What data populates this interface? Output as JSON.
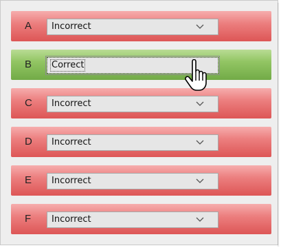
{
  "rows": [
    {
      "label": "A",
      "value": "Incorrect",
      "state": "incorrect"
    },
    {
      "label": "B",
      "value": "Correct",
      "state": "correct"
    },
    {
      "label": "C",
      "value": "Incorrect",
      "state": "incorrect"
    },
    {
      "label": "D",
      "value": "Incorrect",
      "state": "incorrect"
    },
    {
      "label": "E",
      "value": "Incorrect",
      "state": "incorrect"
    },
    {
      "label": "F",
      "value": "Incorrect",
      "state": "incorrect"
    }
  ],
  "colors": {
    "incorrect": "#e06060",
    "correct": "#80b852",
    "panel_background": "#eeeeee",
    "select_background": "#e6e6e6"
  },
  "icons": {
    "dropdown": "chevron-down-icon",
    "cursor": "hand-pointer-cursor-icon"
  }
}
